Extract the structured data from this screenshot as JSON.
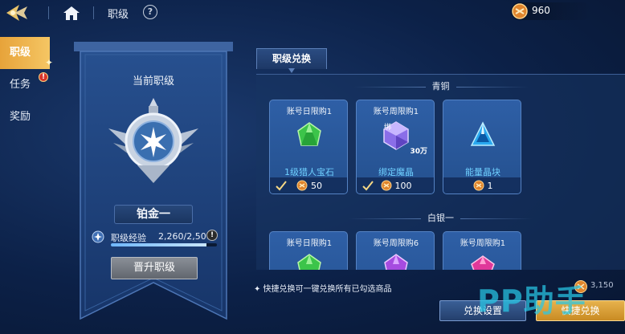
{
  "header": {
    "title": "职级",
    "currency_value": "960"
  },
  "sidebar": {
    "items": [
      {
        "label": "职级"
      },
      {
        "label": "任务",
        "badge": "!"
      },
      {
        "label": "奖励"
      }
    ]
  },
  "rank_panel": {
    "title": "当前职级",
    "rank_name": "铂金一",
    "xp_label": "职级经验",
    "xp_value": "2,260/2,500",
    "xp_progress": 0.904,
    "xp_info": "!",
    "promote_button": "晋升职级"
  },
  "exchange": {
    "tab_label": "职级兑换",
    "sections": [
      {
        "title": "青铜",
        "items": [
          {
            "limit": "账号日限购1",
            "name": "1级猎人宝石",
            "price": "50",
            "checked": true,
            "gem": "green"
          },
          {
            "limit": "账号周限购1",
            "name": "绑定魔晶",
            "price": "100",
            "checked": true,
            "gem": "purple",
            "bind_tag": "绑",
            "qty": "30万"
          },
          {
            "limit": "",
            "name": "能量晶块",
            "price": "1",
            "checked": false,
            "gem": "blue"
          }
        ]
      },
      {
        "title": "白银一",
        "items": [
          {
            "limit": "账号日限购1",
            "gem": "green"
          },
          {
            "limit": "账号周限购6",
            "gem": "purple"
          },
          {
            "limit": "账号周限购1",
            "gem": "pink"
          }
        ]
      }
    ],
    "footer_note": "✦ 快捷兑换可一键兑换所有已勾选商品",
    "footer_cost": "3,150",
    "settings_button": "兑换设置",
    "quick_button": "快捷兑换"
  },
  "watermark": "PP助手",
  "colors": {
    "accent_gold": "#e7a33a",
    "item_name_blue": "#6fd0ff",
    "card_blue": "#2e5fa6",
    "watermark": "#28c8e6"
  },
  "icons": {
    "home": "home-icon",
    "help": "help-icon",
    "coin": "coin-icon",
    "check": "check-icon",
    "emblem": "platinum-rank-emblem"
  }
}
